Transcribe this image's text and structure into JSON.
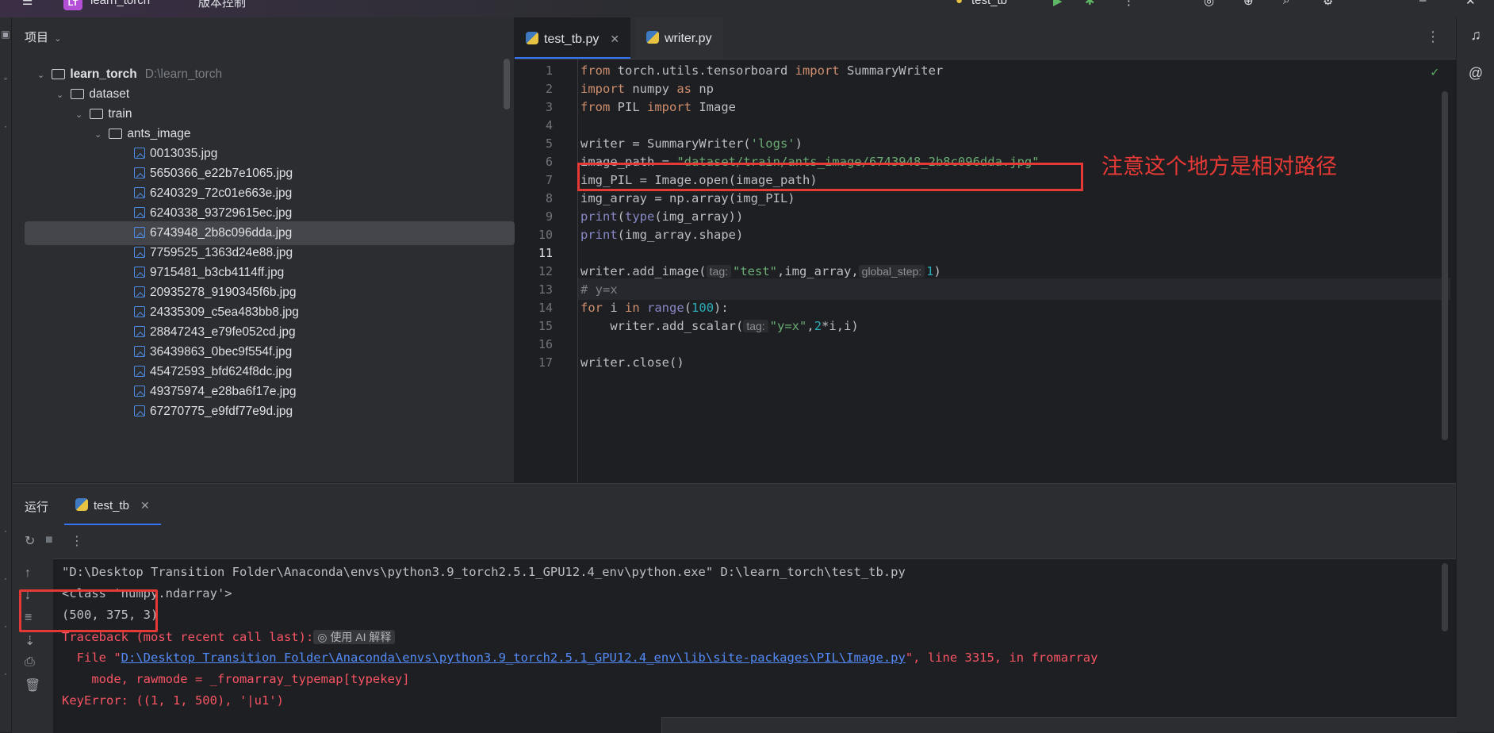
{
  "titlebar": {
    "project_badge": "LT",
    "project_name": "learn_torch",
    "vcs": "版本控制",
    "run_config": "test_tb"
  },
  "project_panel": {
    "header": "项目",
    "root": {
      "name": "learn_torch",
      "path": "D:\\learn_torch"
    },
    "folders": [
      "dataset",
      "train",
      "ants_image"
    ],
    "files": [
      "0013035.jpg",
      "5650366_e22b7e1065.jpg",
      "6240329_72c01e663e.jpg",
      "6240338_93729615ec.jpg",
      "6743948_2b8c096dda.jpg",
      "7759525_1363d24e88.jpg",
      "9715481_b3cb4114ff.jpg",
      "20935278_9190345f6b.jpg",
      "24335309_c5ea483bb8.jpg",
      "28847243_e79fe052cd.jpg",
      "36439863_0bec9f554f.jpg",
      "45472593_bfd624f8dc.jpg",
      "49375974_e28ba6f17e.jpg",
      "67270775_e9fdf77e9d.jpg"
    ]
  },
  "editor": {
    "tabs": [
      {
        "label": "test_tb.py",
        "active": true
      },
      {
        "label": "writer.py",
        "active": false
      }
    ],
    "line_numbers": [
      "1",
      "2",
      "3",
      "4",
      "5",
      "6",
      "7",
      "8",
      "9",
      "10",
      "11",
      "12",
      "13",
      "14",
      "15",
      "16",
      "17"
    ],
    "code": {
      "l1_a": "from",
      "l1_b": " torch.utils.tensorboard ",
      "l1_c": "import",
      "l1_d": " SummaryWriter",
      "l2_a": "import",
      "l2_b": " numpy ",
      "l2_c": "as",
      "l2_d": " np",
      "l3_a": "from",
      "l3_b": " PIL ",
      "l3_c": "import",
      "l3_d": " Image",
      "l5_a": "writer = SummaryWriter(",
      "l5_b": "'logs'",
      "l5_c": ")",
      "l6_a": "image_path = ",
      "l6_b": "\"dataset/train/ants_image/6743948_2b8c096dda.jpg\"",
      "l7": "img_PIL = Image.open(image_path)",
      "l8": "img_array = np.array(img_PIL)",
      "l9_a": "print",
      "l9_b": "(",
      "l9_c": "type",
      "l9_d": "(img_array))",
      "l10_a": "print",
      "l10_b": "(img_array.shape)",
      "l12_a": "writer.add_image(",
      "l12_hint1": "tag:",
      "l12_b": "\"test\"",
      "l12_c": ",img_array,",
      "l12_hint2": "global_step:",
      "l12_d": "1",
      "l12_e": ")",
      "l13": "# y=x",
      "l14_a": "for",
      "l14_b": " i ",
      "l14_c": "in",
      "l14_d": " ",
      "l14_e": "range",
      "l14_f": "(",
      "l14_g": "100",
      "l14_h": "):",
      "l15_a": "    writer.add_scalar(",
      "l15_hint": "tag:",
      "l15_b": "\"y=x\"",
      "l15_c": ",",
      "l15_d": "2",
      "l15_e": "*i,i)",
      "l17": "writer.close()"
    },
    "annotation": "注意这个地方是相对路径"
  },
  "run_panel": {
    "label": "运行",
    "tab": "test_tb",
    "output": {
      "o1": "\"D:\\Desktop Transition Folder\\Anaconda\\envs\\python3.9_torch2.5.1_GPU12.4_env\\python.exe\" D:\\learn_torch\\test_tb.py",
      "o2": "<class 'numpy.ndarray'>",
      "o3": "(500, 375, 3)",
      "o4": "Traceback (most recent call last):",
      "o4_ai": "使用 AI 解释",
      "o5_a": "  File \"",
      "o5_link": "D:\\Desktop Transition Folder\\Anaconda\\envs\\python3.9_torch2.5.1_GPU12.4_env\\lib\\site-packages\\PIL\\Image.py",
      "o5_b": "\", line 3315, in fromarray",
      "o6": "    mode, rawmode = _fromarray_typemap[typekey]",
      "o7": "KeyError: ((1, 1, 500), '|u1')"
    }
  },
  "icons": [
    "menu-icon",
    "folder-icon",
    "image-file-icon",
    "python-file-icon",
    "more-icon",
    "check-icon",
    "bell-icon",
    "ai-spiral-icon",
    "rerun-icon",
    "stop-icon",
    "arrow-up-icon",
    "arrow-down-icon",
    "wrap-icon",
    "scroll-end-icon",
    "print-icon",
    "trash-icon",
    "run-icon",
    "debug-icon",
    "search-icon",
    "gear-icon",
    "add-user-icon"
  ]
}
